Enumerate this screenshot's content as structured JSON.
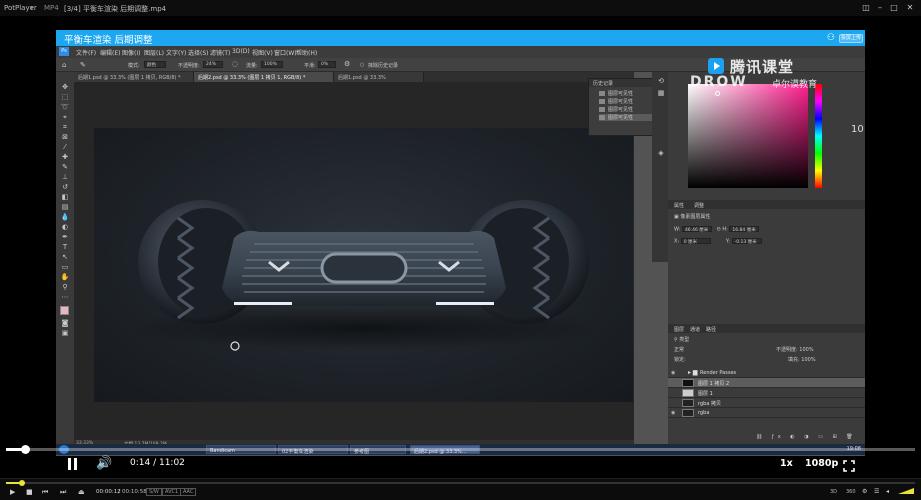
{
  "window": {
    "app_name": "PotPlayer",
    "format": "MP4",
    "file_title": "[3/4] 平衡车渲染 后期调整.mp4"
  },
  "course": {
    "title": "平衡车渲染 后期调整",
    "share_label": "投屏上传"
  },
  "watermark": {
    "brand_cn": "腾讯课堂",
    "brand_en": "DROW",
    "school": "卓尔谟教育"
  },
  "photoshop": {
    "logo": "Ps",
    "menu": [
      "文件(F)",
      "编辑(E)",
      "图像(I)",
      "图层(L)",
      "文字(Y)",
      "选择(S)",
      "滤镜(T)",
      "3D(D)",
      "视图(V)",
      "窗口(W)",
      "帮助(H)"
    ],
    "options": {
      "mode_label": "模式:",
      "mode_value": "颜色",
      "opacity_label": "不透明度:",
      "opacity_value": "24%",
      "flow_label": "流量:",
      "flow_value": "100%",
      "smooth_label": "平滑:",
      "smooth_value": "0%",
      "history_label": "抹除历史记录"
    },
    "tabs": [
      {
        "label": "后期1.psd @ 33.3% (图层 1 拷贝, RGB/8) *",
        "active": false
      },
      {
        "label": "后期2.psd @ 33.3% (图层 1 拷贝 1, RGB/8) *",
        "active": true
      },
      {
        "label": "后期1.psd @ 33.3%",
        "active": false
      }
    ],
    "status": {
      "zoom": "33.33%",
      "doc": "文档:13.7M/109.2M"
    },
    "history": {
      "title": "历史记录",
      "items": [
        "图层可见性",
        "图层可见性",
        "图层可见性",
        "图层可见性"
      ]
    },
    "right_number": "10",
    "properties": {
      "tabs": [
        "属性",
        "调整"
      ],
      "kind": "像素图层属性",
      "w_label": "W:",
      "w_value": "46.46 厘米",
      "h_label": "H:",
      "h_value": "16.84 厘米",
      "x_label": "X:",
      "x_value": "0 厘米",
      "y_label": "Y:",
      "y_value": "-0.13 厘米"
    },
    "layers": {
      "tabs": [
        "图层",
        "通道",
        "路径"
      ],
      "filter_label": "类型",
      "blend": "正常",
      "opacity_label": "不透明度:",
      "opacity_value": "100%",
      "lock_label": "锁定:",
      "fill_label": "填充:",
      "fill_value": "100%",
      "rows": [
        {
          "name": "Render Passes",
          "kind": "group",
          "selected": false
        },
        {
          "name": "图层 1 拷贝 2",
          "kind": "layer",
          "selected": true
        },
        {
          "name": "图层 1",
          "kind": "layer",
          "selected": false
        },
        {
          "name": "rgba 拷贝",
          "kind": "layer",
          "selected": false
        },
        {
          "name": "rgba",
          "kind": "layer",
          "selected": false
        }
      ]
    }
  },
  "taskbar": {
    "items": [
      "Bandicam",
      "02平衡车渲染",
      "参考图",
      "后期2.psd @ 33.3%..."
    ],
    "clock": "19:08"
  },
  "player": {
    "time": "0:14 / 11:02",
    "progress": 0.021,
    "speed": "1x",
    "quality": "1080p"
  },
  "potbar": {
    "current_time": "00:00:12",
    "total_time": "00:10:58",
    "tags": [
      "S/W",
      "AVC1",
      "AAC"
    ],
    "right_tags": [
      "3D",
      "360"
    ],
    "progress": 0.018
  },
  "icons": {
    "minimize": "minimize-icon",
    "close": "close-icon",
    "play": "pause-icon",
    "volume": "volume-icon",
    "fullscreen": "fullscreen-icon"
  }
}
